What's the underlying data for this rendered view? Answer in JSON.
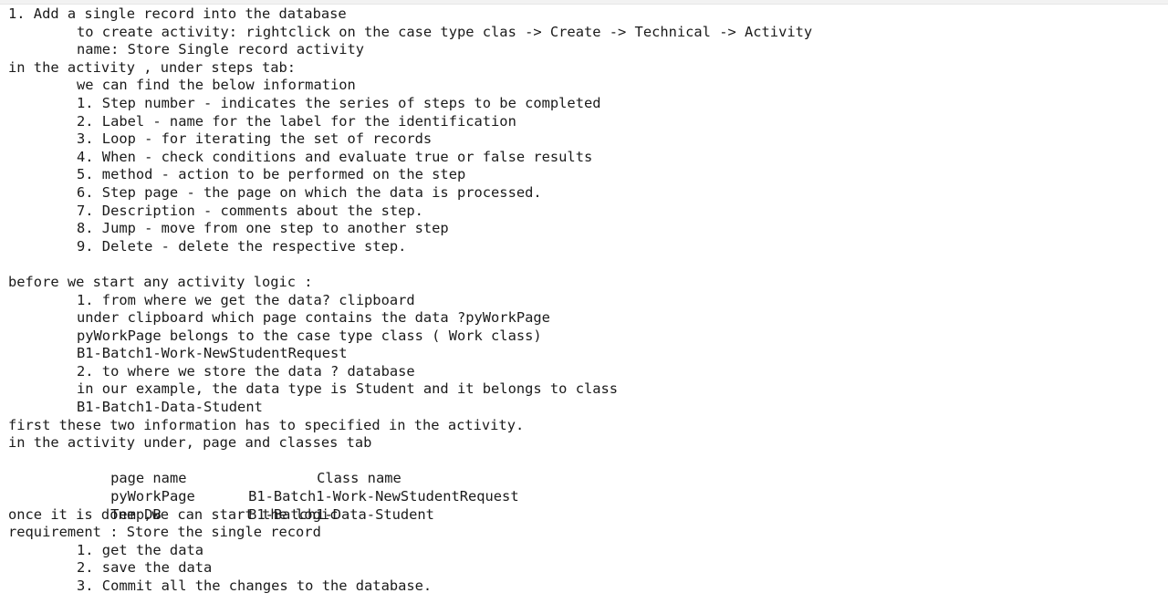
{
  "notes": {
    "intro": {
      "title": "1. Add a single record into the database",
      "create_steps": "to create activity: rightclick on the case type clas -> Create -> Technical -> Activity",
      "name": "name: Store Single record activity"
    },
    "steps_tab": {
      "heading": "in the activity , under steps tab:",
      "lead": "we can find the below information",
      "items": [
        "1. Step number - indicates the series of steps to be completed",
        "2. Label - name for the label for the identification",
        "3. Loop - for iterating the set of records",
        "4. When - check conditions and evaluate true or false results",
        "5. method - action to be performed on the step",
        "6. Step page - the page on which the data is processed.",
        "7. Description - comments about the step.",
        "8. Jump - move from one step to another step",
        "9. Delete - delete the respective step."
      ]
    },
    "before_start": {
      "heading": "before we start any activity logic :",
      "lines": [
        "1. from where we get the data? clipboard",
        "under clipboard which page contains the data ?pyWorkPage",
        "pyWorkPage belongs to the case type class ( Work class)",
        "B1-Batch1-Work-NewStudentRequest",
        "2. to where we store the data ? database",
        "in our example, the data type is Student and it belongs to class",
        "B1-Batch1-Data-Student"
      ]
    },
    "first_info": "first these two information has to specified in the activity.",
    "pages_classes": {
      "heading": "in the activity under, page and classes tab",
      "col_page": "page name",
      "col_class": "Class name",
      "rows": [
        {
          "page": "pyWorkPage",
          "class": "B1-Batch1-Work-NewStudentRequest"
        },
        {
          "page": "TempDB",
          "class": "B1-Batch1-Data-Student"
        }
      ]
    },
    "once_done": "once it is done ,we can start the logic",
    "requirement": {
      "heading": "requirement : Store the single record",
      "items": [
        "1. get the data",
        "2. save the data",
        "3. Commit all the changes to the database."
      ]
    }
  }
}
